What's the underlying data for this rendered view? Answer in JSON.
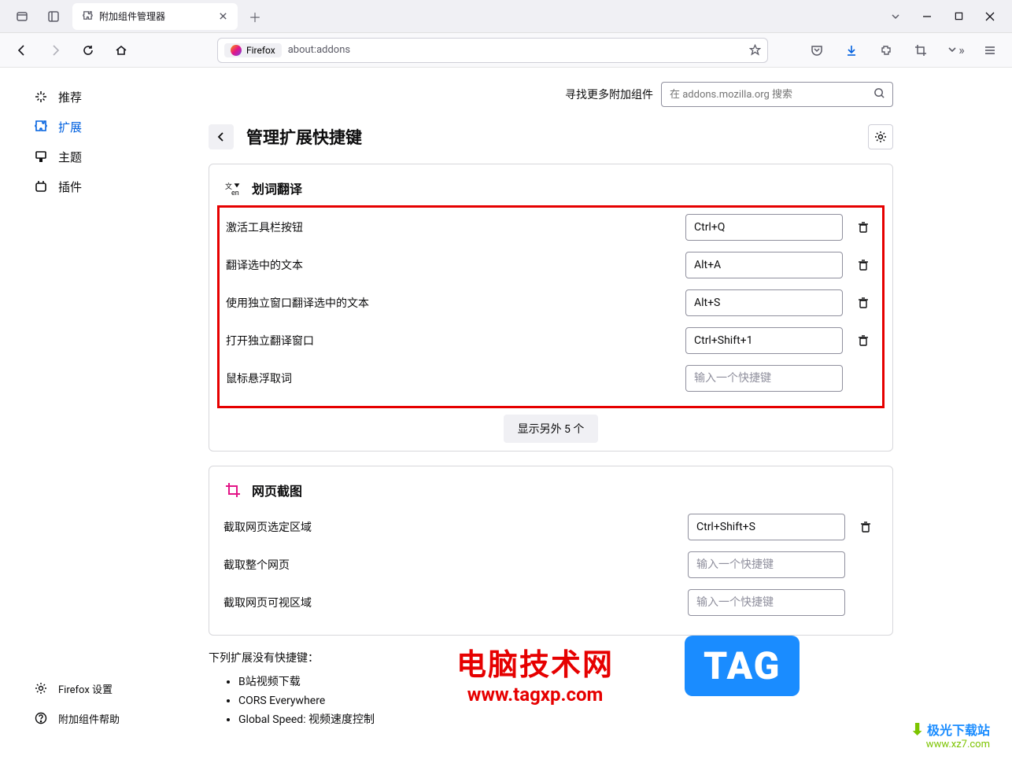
{
  "window": {
    "tab_title": "附加组件管理器"
  },
  "urlbar": {
    "pill": "Firefox",
    "url": "about:addons"
  },
  "sidebar": {
    "items": [
      {
        "label": "推荐"
      },
      {
        "label": "扩展"
      },
      {
        "label": "主题"
      },
      {
        "label": "插件"
      }
    ],
    "settings": "Firefox 设置",
    "help": "附加组件帮助"
  },
  "search": {
    "label": "寻找更多附加组件",
    "placeholder": "在 addons.mozilla.org 搜索"
  },
  "page": {
    "title": "管理扩展快捷键"
  },
  "ext1": {
    "name": "划词翻译",
    "rows": [
      {
        "label": "激活工具栏按钮",
        "value": "Ctrl+Q"
      },
      {
        "label": "翻译选中的文本",
        "value": "Alt+A"
      },
      {
        "label": "使用独立窗口翻译选中的文本",
        "value": "Alt+S"
      },
      {
        "label": "打开独立翻译窗口",
        "value": "Ctrl+Shift+1"
      },
      {
        "label": "鼠标悬浮取词",
        "value": "",
        "placeholder": "输入一个快捷键"
      }
    ],
    "show_more": "显示另外 5 个"
  },
  "ext2": {
    "name": "网页截图",
    "rows": [
      {
        "label": "截取网页选定区域",
        "value": "Ctrl+Shift+S"
      },
      {
        "label": "截取整个网页",
        "value": "",
        "placeholder": "输入一个快捷键"
      },
      {
        "label": "截取网页可视区域",
        "value": "",
        "placeholder": "输入一个快捷键"
      }
    ]
  },
  "no_shortcut": {
    "title": "下列扩展没有快捷键：",
    "items": [
      "B站视频下载",
      "CORS Everywhere",
      "Global Speed: 视频速度控制"
    ]
  },
  "wm1": {
    "l1": "电脑技术网",
    "l2": "www.tagxp.com"
  },
  "tag": "TAG",
  "wm2": {
    "l1": "极光下载站",
    "l2": "www.xz7.com"
  }
}
